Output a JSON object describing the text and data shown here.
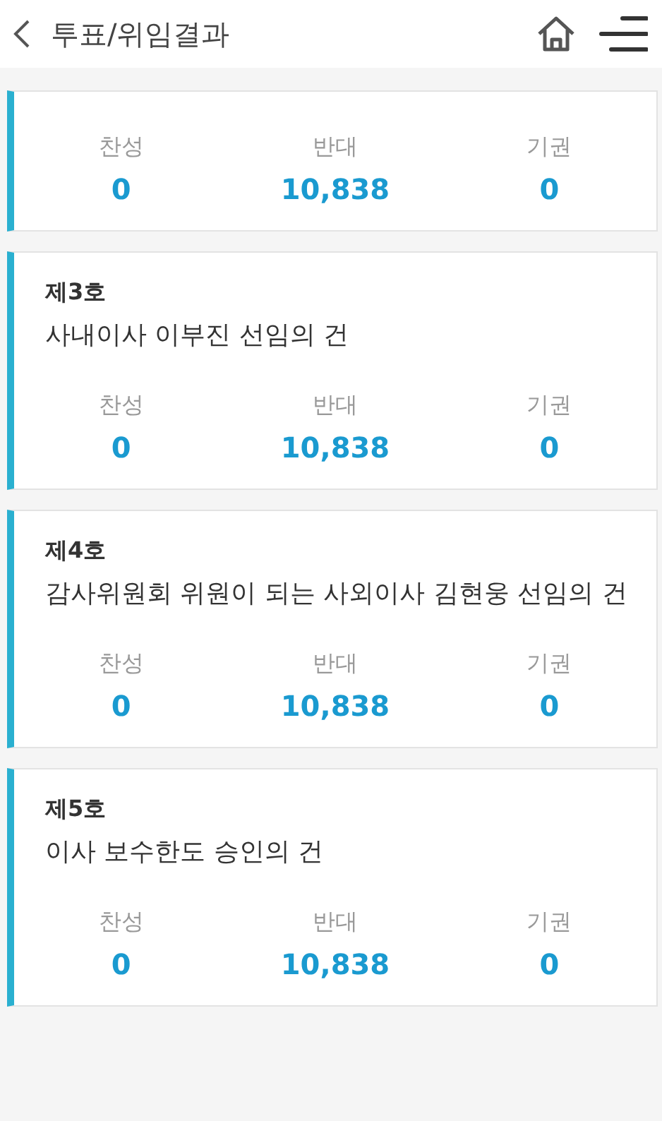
{
  "header": {
    "title": "투표/위임결과"
  },
  "items": [
    {
      "stats": [
        {
          "label": "찬성",
          "value": "0"
        },
        {
          "label": "반대",
          "value": "10,838"
        },
        {
          "label": "기권",
          "value": "0"
        }
      ]
    },
    {
      "number": "제3호",
      "subject": "사내이사 이부진 선임의 건",
      "stats": [
        {
          "label": "찬성",
          "value": "0"
        },
        {
          "label": "반대",
          "value": "10,838"
        },
        {
          "label": "기권",
          "value": "0"
        }
      ]
    },
    {
      "number": "제4호",
      "subject": "감사위원회 위원이 되는 사외이사 김현웅 선임의 건",
      "stats": [
        {
          "label": "찬성",
          "value": "0"
        },
        {
          "label": "반대",
          "value": "10,838"
        },
        {
          "label": "기권",
          "value": "0"
        }
      ]
    },
    {
      "number": "제5호",
      "subject": "이사 보수한도 승인의 건",
      "stats": [
        {
          "label": "찬성",
          "value": "0"
        },
        {
          "label": "반대",
          "value": "10,838"
        },
        {
          "label": "기권",
          "value": "0"
        }
      ]
    }
  ]
}
